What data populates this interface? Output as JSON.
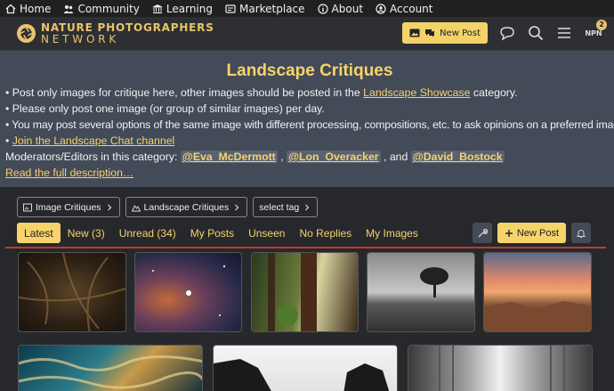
{
  "topnav": [
    {
      "label": "Home",
      "icon": "home-icon"
    },
    {
      "label": "Community",
      "icon": "community-icon"
    },
    {
      "label": "Learning",
      "icon": "learning-icon"
    },
    {
      "label": "Marketplace",
      "icon": "marketplace-icon"
    },
    {
      "label": "About",
      "icon": "info-icon"
    },
    {
      "label": "Account",
      "icon": "account-icon"
    }
  ],
  "header": {
    "logo_line1": "NATURE PHOTOGRAPHERS",
    "logo_line2": "NETWORK",
    "new_post": "New Post",
    "npn_label": "NPN",
    "npn_badge": "2"
  },
  "banner": {
    "title": "Landscape Critiques",
    "line1_pre": "• Post only images for critique here, other images should be posted in the ",
    "line1_link": "Landscape Showcase",
    "line1_post": " category.",
    "line2": "• Please only post one image (or group of similar images) per day.",
    "line3": "• You may post several options of the same image with different processing, compositions, etc. to ask opinions on a preferred image.",
    "line4_bullet": "• ",
    "line4_link": "Join the Landscape Chat channel",
    "moderators_label": "Moderators/Editors in this category: ",
    "mod1": "@Eva_McDermott",
    "sep1": " , ",
    "mod2": "@Lon_Overacker",
    "sep2": " , and ",
    "mod3": "@David_Bostock",
    "read_more": "Read the full description…"
  },
  "breadcrumbs": {
    "crumb1": "Image Critiques",
    "crumb2": "Landscape Critiques",
    "crumb3": "select tag"
  },
  "tabs": [
    "Latest",
    "New (3)",
    "Unread (34)",
    "My Posts",
    "Unseen",
    "No Replies",
    "My Images"
  ],
  "tab_actions": {
    "new_post": "New Post"
  },
  "colors": {
    "accent": "#f6d36b",
    "banner_bg": "#434a58",
    "active_line": "#c0392b"
  }
}
